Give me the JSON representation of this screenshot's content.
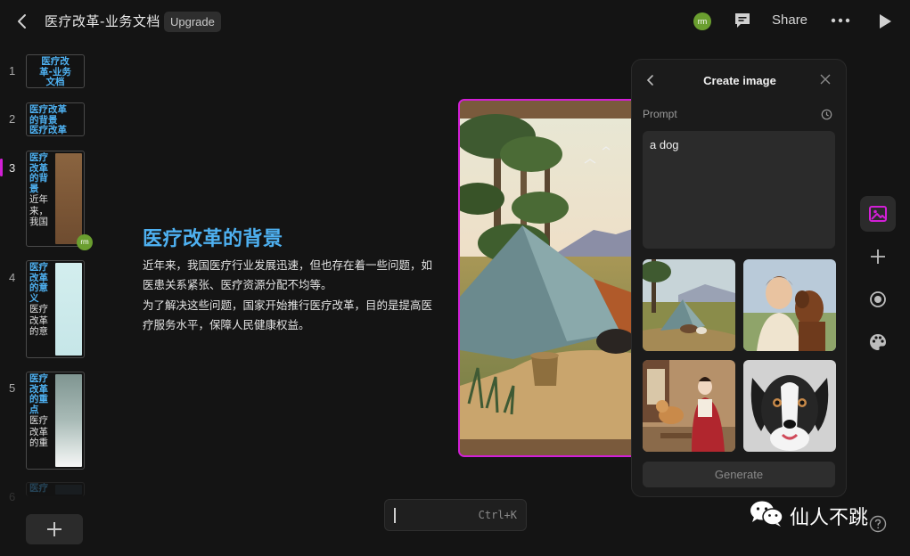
{
  "header": {
    "doc_title": "医疗改革-业务文档",
    "upgrade_label": "Upgrade",
    "avatar_initials": "rm",
    "share_label": "Share"
  },
  "slides": [
    {
      "number": "1",
      "lines": [
        "医疗改",
        "革-业务",
        "文档"
      ]
    },
    {
      "number": "2",
      "title_lines": [
        "医疗改革",
        "的背景",
        "医疗改革"
      ]
    },
    {
      "number": "3",
      "title_lines": [
        "医疗",
        "改革",
        "的背",
        "景"
      ],
      "body_lines": [
        "近年",
        "来，",
        "我国"
      ]
    },
    {
      "number": "4",
      "title_lines": [
        "医疗",
        "改革",
        "的意",
        "义"
      ],
      "body_lines": [
        "医疗",
        "改革",
        "的意"
      ]
    },
    {
      "number": "5",
      "title_lines": [
        "医疗",
        "改革",
        "的重",
        "点"
      ],
      "body_lines": [
        "医疗",
        "改革",
        "的重"
      ]
    },
    {
      "number": "6",
      "title_lines": [
        "医疗"
      ]
    }
  ],
  "thumb_avatar": "rm",
  "slide": {
    "heading": "医疗改革的背景",
    "paragraphs": [
      "近年来，我国医疗行业发展迅速，但也存在着一些问题，如医患关系紧张、医疗资源分配不均等。",
      "为了解决这些问题，国家开始推行医疗改革，目的是提高医疗服务水平，保障人民健康权益。"
    ]
  },
  "panel": {
    "title": "Create image",
    "prompt_label": "Prompt",
    "prompt_value": "a dog",
    "generate_label": "Generate",
    "results": [
      "dog-by-tent",
      "woman-with-dog",
      "woman-feeding-dog",
      "dog-portrait"
    ]
  },
  "command": {
    "shortcut": "Ctrl+K"
  },
  "watermark": {
    "text": "仙人不跳"
  },
  "colors": {
    "accent": "#d21fd6",
    "heading": "#4eb0f0",
    "background": "#141414",
    "avatar": "#6a9e2f"
  }
}
